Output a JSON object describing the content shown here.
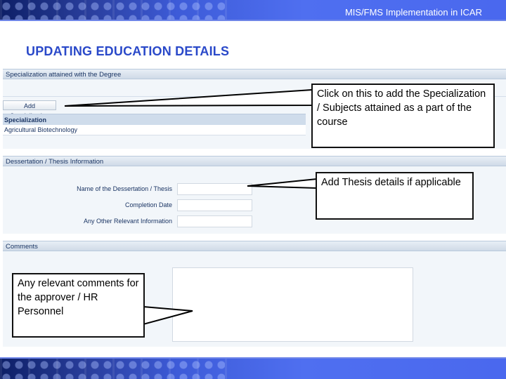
{
  "header": {
    "title": "MIS/FMS Implementation in ICAR"
  },
  "page": {
    "title": "UPDATING EDUCATION DETAILS"
  },
  "specialization": {
    "section_title": "Specialization attained with the Degree",
    "add_button": "Add Specialization",
    "table_header": "Specialization",
    "rows": [
      "Agricultural Biotechnology"
    ]
  },
  "thesis": {
    "section_title": "Dessertation / Thesis Information",
    "fields": [
      {
        "label": "Name of the Dessertation / Thesis",
        "value": ""
      },
      {
        "label": "Completion Date",
        "value": ""
      },
      {
        "label": "Any Other Relevant Information",
        "value": ""
      }
    ]
  },
  "comments": {
    "section_title": "Comments",
    "value": ""
  },
  "callouts": {
    "add_spec": "Click on this to add the Specialization / Subjects attained as a part of the course",
    "thesis": "Add Thesis details if applicable",
    "comments": "Any relevant comments for the approver / HR Personnel"
  },
  "colors": {
    "title": "#2a49c9",
    "banner": "#4f6ff0",
    "panel": "#f2f6fa"
  },
  "icons": {
    "resize": "resize-grip-icon"
  }
}
